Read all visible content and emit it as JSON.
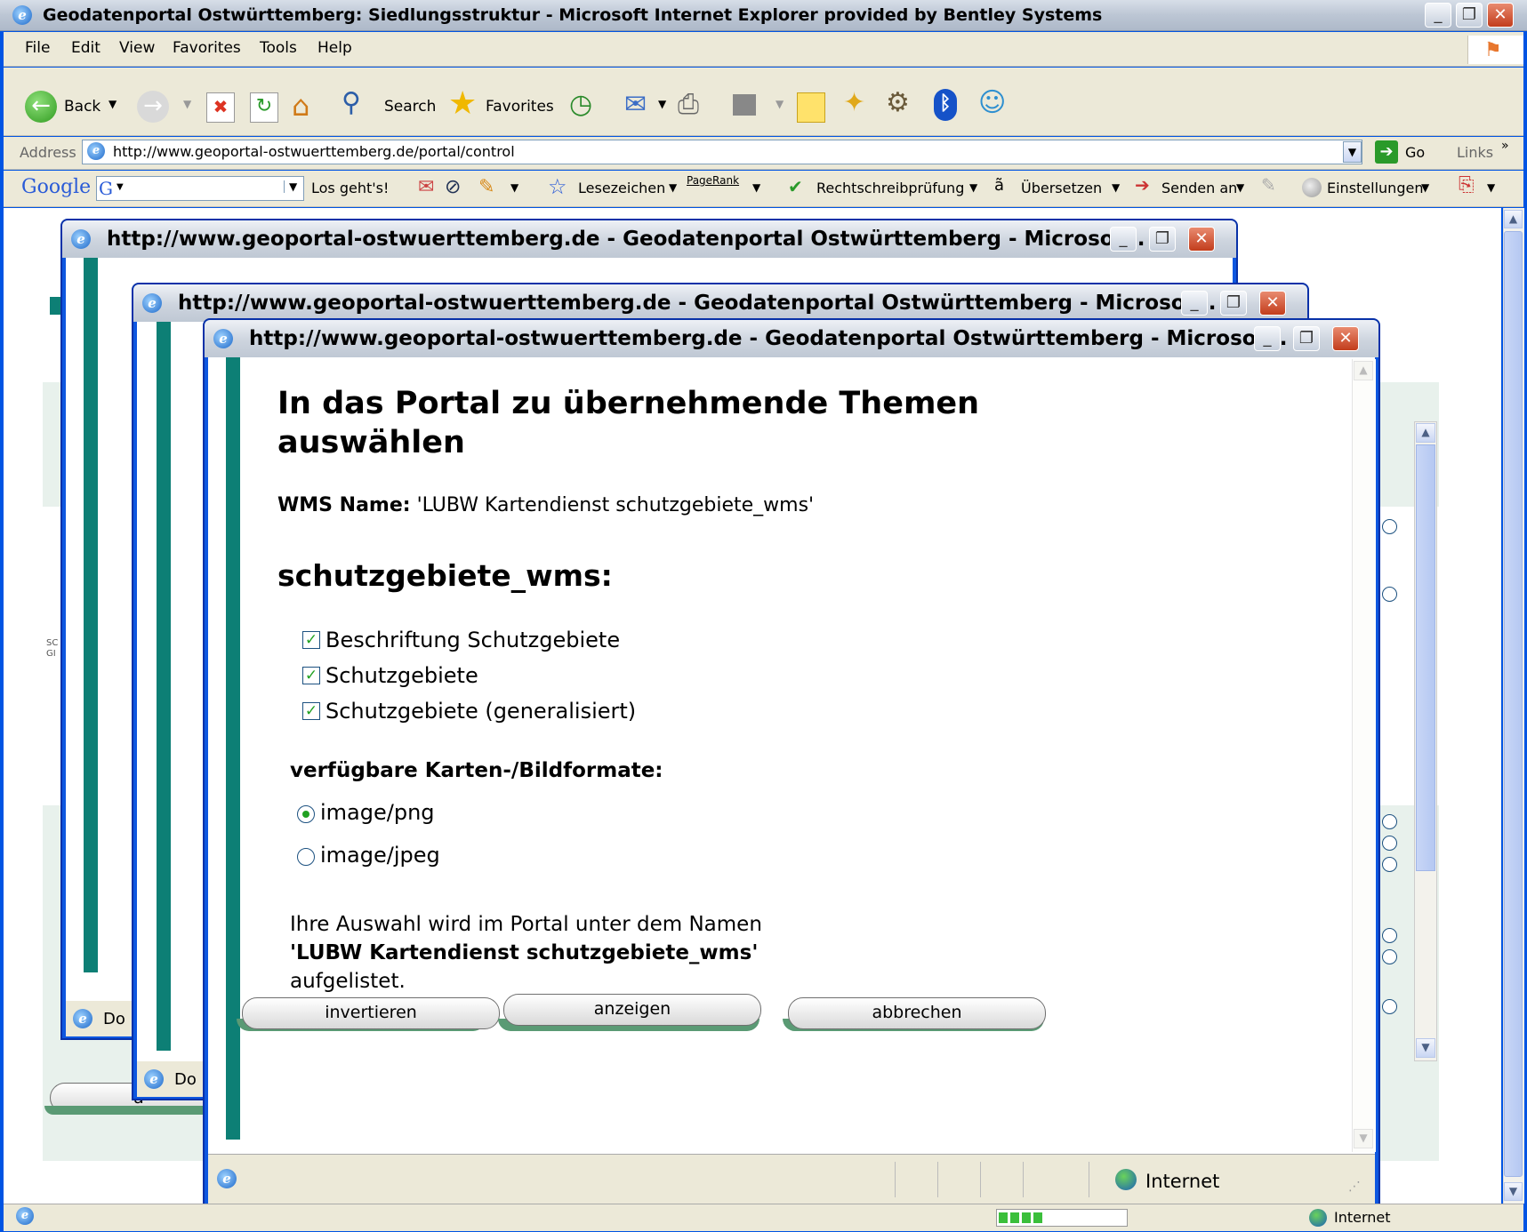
{
  "main_window": {
    "title": "Geodatenportal Ostwürttemberg: Siedlungsstruktur - Microsoft Internet Explorer provided by Bentley Systems",
    "menu": [
      "File",
      "Edit",
      "View",
      "Favorites",
      "Tools",
      "Help"
    ],
    "toolbar": {
      "back": "Back",
      "search": "Search",
      "favorites": "Favorites"
    },
    "address": {
      "label": "Address",
      "url": "http://www.geoportal-ostwuerttemberg.de/portal/control",
      "go": "Go",
      "links": "Links"
    },
    "google": {
      "brand": "Google",
      "search_btn": "Los geht's!",
      "bookmarks": "Lesezeichen",
      "pagerank": "PageRank",
      "spellcheck": "Rechtschreibprüfung",
      "translate": "Übersetzen",
      "send": "Senden an",
      "settings": "Einstellungen"
    },
    "status": {
      "zone": "Internet"
    }
  },
  "background_popups": [
    {
      "title": "http://www.geoportal-ostwuerttemberg.de - Geodatenportal Ostwürttemberg - Microsof...",
      "status": "Do"
    },
    {
      "title": "http://www.geoportal-ostwuerttemberg.de - Geodatenportal Ostwürttemberg - Microsof...",
      "status": "Do"
    }
  ],
  "dialog": {
    "window_title": "http://www.geoportal-ostwuerttemberg.de - Geodatenportal Ostwürttemberg - Microsof...",
    "heading_line1": "In das Portal zu übernehmende Themen",
    "heading_line2": "auswählen",
    "wms_label": "WMS Name:",
    "wms_value": "'LUBW Kartendienst schutzgebiete_wms'",
    "section_title": "schutzgebiete_wms:",
    "layers": [
      {
        "label": "Beschriftung Schutzgebiete",
        "checked": true
      },
      {
        "label": "Schutzgebiete",
        "checked": true
      },
      {
        "label": "Schutzgebiete (generalisiert)",
        "checked": true
      }
    ],
    "formats_title": "verfügbare Karten-/Bildformate:",
    "formats": [
      {
        "label": "image/png",
        "selected": true
      },
      {
        "label": "image/jpeg",
        "selected": false
      }
    ],
    "info_line1": "Ihre Auswahl wird im Portal unter dem Namen",
    "info_name": "'LUBW Kartendienst schutzgebiete_wms'",
    "info_line3": "aufgelistet.",
    "buttons": {
      "invert": "invertieren",
      "show": "anzeigen",
      "cancel": "abbrechen"
    },
    "status_zone": "Internet"
  },
  "background_page": {
    "button_fragment": "a",
    "side_text": "SC GI"
  },
  "colors": {
    "teal": "#0d7f75",
    "xp_blue": "#0e57e0",
    "panel_green": "#e8f1ec"
  }
}
